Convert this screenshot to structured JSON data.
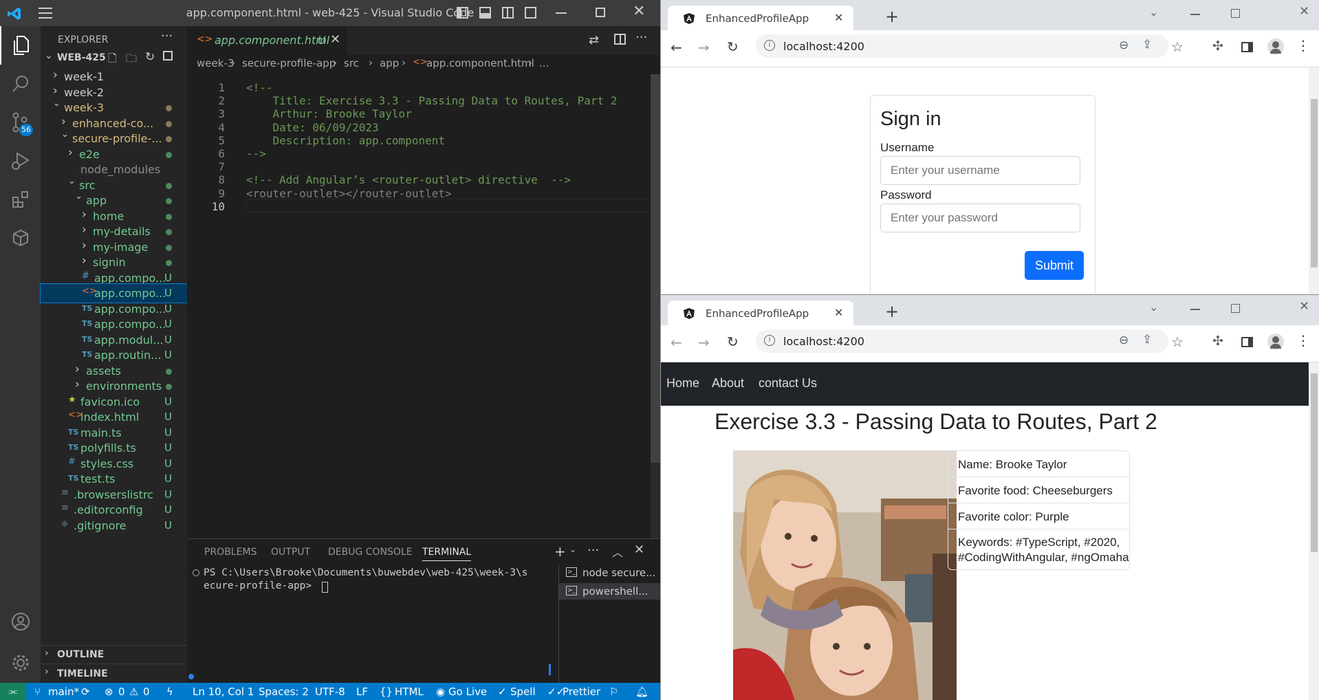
{
  "vscode": {
    "window_title": "app.component.html - web-425 - Visual Studio Code",
    "explorer_title": "EXPLORER",
    "root_folder": "WEB-425",
    "scm_badge": "56",
    "tree": [
      {
        "label": "week-1",
        "status": ""
      },
      {
        "label": "week-2",
        "status": ""
      },
      {
        "label": "week-3",
        "status": "dot"
      },
      {
        "label": "enhanced-co...",
        "status": "dot"
      },
      {
        "label": "secure-profile-...",
        "status": "dot"
      },
      {
        "label": "e2e",
        "status": "dot"
      },
      {
        "label": "node_modules",
        "status": ""
      },
      {
        "label": "src",
        "status": "dot"
      },
      {
        "label": "app",
        "status": "dot"
      },
      {
        "label": "home",
        "status": "dot"
      },
      {
        "label": "my-details",
        "status": "dot"
      },
      {
        "label": "my-image",
        "status": "dot"
      },
      {
        "label": "signin",
        "status": "dot"
      },
      {
        "label": "app.compo...",
        "status": "U"
      },
      {
        "label": "app.compo...",
        "status": "U"
      },
      {
        "label": "app.compo...",
        "status": "U"
      },
      {
        "label": "app.compo...",
        "status": "U"
      },
      {
        "label": "app.modul...",
        "status": "U"
      },
      {
        "label": "app.routin...",
        "status": "U"
      },
      {
        "label": "assets",
        "status": "dot"
      },
      {
        "label": "environments",
        "status": "dot"
      },
      {
        "label": "favicon.ico",
        "status": "U"
      },
      {
        "label": "index.html",
        "status": "U"
      },
      {
        "label": "main.ts",
        "status": "U"
      },
      {
        "label": "polyfills.ts",
        "status": "U"
      },
      {
        "label": "styles.css",
        "status": "U"
      },
      {
        "label": "test.ts",
        "status": "U"
      },
      {
        "label": ".browserslistrc",
        "status": "U"
      },
      {
        "label": ".editorconfig",
        "status": "U"
      },
      {
        "label": ".gitignore",
        "status": "U"
      }
    ],
    "outline": "OUTLINE",
    "timeline": "TIMELINE",
    "tab_label": "app.component.html",
    "tab_status": "U",
    "breadcrumb": [
      "week-3",
      "secure-profile-app",
      "src",
      "app",
      "app.component.html",
      "..."
    ],
    "code_lines": [
      "<!--",
      "    Title: Exercise 3.3 - Passing Data to Routes, Part 2",
      "    Arthur: Brooke Taylor",
      "    Date: 06/09/2023",
      "    Description: app.component",
      "-->",
      "",
      "<!-- Add Angular’s <router-outlet> directive  -->",
      "<router-outlet></router-outlet>",
      ""
    ],
    "line_numbers": [
      "1",
      "2",
      "3",
      "4",
      "5",
      "6",
      "7",
      "8",
      "9",
      "10"
    ],
    "panel_tabs": [
      "PROBLEMS",
      "OUTPUT",
      "DEBUG CONSOLE",
      "TERMINAL"
    ],
    "terminal_line1": "PS C:\\Users\\Brooke\\Documents\\buwebdev\\web-425\\week-3\\s",
    "terminal_line2": "ecure-profile-app> ",
    "terminals": [
      "node secure...",
      "powershell..."
    ],
    "status": {
      "branch": "main*",
      "errors": "0",
      "warnings": "0",
      "position": "Ln 10, Col 1",
      "spaces": "Spaces: 2",
      "encoding": "UTF-8",
      "eol": "LF",
      "language": "HTML",
      "golive": "Go Live",
      "spell": "Spell",
      "prettier": "Prettier"
    }
  },
  "browser1": {
    "tab_title": "EnhancedProfileApp",
    "url": "localhost:4200",
    "signin_title": "Sign in",
    "username_label": "Username",
    "username_placeholder": "Enter your username",
    "password_label": "Password",
    "password_placeholder": "Enter your password",
    "submit": "Submit"
  },
  "browser2": {
    "tab_title": "EnhancedProfileApp",
    "url": "localhost:4200",
    "nav": [
      "Home",
      "About",
      "contact Us"
    ],
    "heading": "Exercise 3.3 - Passing Data to Routes, Part 2",
    "details": [
      "Name: Brooke Taylor",
      "Favorite food: Cheeseburgers",
      "Favorite color: Purple",
      "Keywords: #TypeScript, #2020,",
      "#CodingWithAngular, #ngOmaha"
    ]
  }
}
